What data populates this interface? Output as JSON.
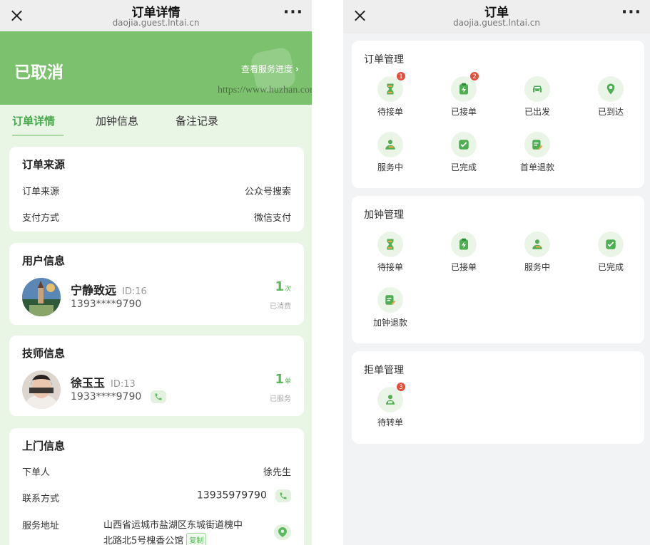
{
  "left": {
    "nav": {
      "title": "订单详情",
      "subtitle": "daojia.guest.lntai.cn",
      "more": "···"
    },
    "status": {
      "title": "已取消",
      "link": "查看服务进度",
      "link_chevron": "›"
    },
    "watermark": "https://www.huzhan.com/ishop52942",
    "tabs": [
      {
        "label": "订单详情",
        "active": true
      },
      {
        "label": "加钟信息",
        "active": false
      },
      {
        "label": "备注记录",
        "active": false
      }
    ],
    "order_source": {
      "title": "订单来源",
      "rows": [
        {
          "label": "订单来源",
          "value": "公众号搜索"
        },
        {
          "label": "支付方式",
          "value": "微信支付"
        }
      ]
    },
    "user_info": {
      "title": "用户信息",
      "name": "宁静致远",
      "id": "ID:16",
      "phone": "1393****9790",
      "count": "1",
      "count_unit": "次",
      "count_label": "已消费"
    },
    "tech_info": {
      "title": "技师信息",
      "name": "徐玉玉",
      "id": "ID:13",
      "phone": "1933****9790",
      "count": "1",
      "count_unit": "单",
      "count_label": "已服务"
    },
    "visit_info": {
      "title": "上门信息",
      "orderer_label": "下单人",
      "orderer_value": "徐先生",
      "contact_label": "联系方式",
      "contact_value": "13935979790",
      "address_label": "服务地址",
      "address_line1": "山西省运城市盐湖区东城街道槐中",
      "address_line2": "北路北5号槐香公馆",
      "copy": "复制"
    }
  },
  "right": {
    "nav": {
      "title": "订单",
      "subtitle": "daojia.guest.lntai.cn",
      "more": "···"
    },
    "order_mgmt": {
      "title": "订单管理",
      "items": [
        {
          "label": "待接单",
          "icon": "hourglass-icon",
          "badge": "1"
        },
        {
          "label": "已接单",
          "icon": "clipboard-bolt-icon",
          "badge": "2"
        },
        {
          "label": "已出发",
          "icon": "car-icon",
          "badge": ""
        },
        {
          "label": "已到达",
          "icon": "location-pin-icon",
          "badge": ""
        },
        {
          "label": "服务中",
          "icon": "person-icon",
          "badge": ""
        },
        {
          "label": "已完成",
          "icon": "check-box-icon",
          "badge": ""
        },
        {
          "label": "首单退款",
          "icon": "edit-doc-icon",
          "badge": ""
        }
      ]
    },
    "addon_mgmt": {
      "title": "加钟管理",
      "items": [
        {
          "label": "待接单",
          "icon": "hourglass-icon",
          "badge": ""
        },
        {
          "label": "已接单",
          "icon": "clipboard-bolt-icon",
          "badge": ""
        },
        {
          "label": "服务中",
          "icon": "person-icon",
          "badge": ""
        },
        {
          "label": "已完成",
          "icon": "check-box-icon",
          "badge": ""
        },
        {
          "label": "加钟退款",
          "icon": "edit-doc-icon",
          "badge": ""
        }
      ]
    },
    "reject_mgmt": {
      "title": "拒单管理",
      "items": [
        {
          "label": "待转单",
          "icon": "transfer-person-icon",
          "badge": "3"
        }
      ]
    }
  },
  "colors": {
    "brand_green": "#7cc26e",
    "accent_green": "#5cb85c",
    "badge_red": "#e54d3b"
  }
}
